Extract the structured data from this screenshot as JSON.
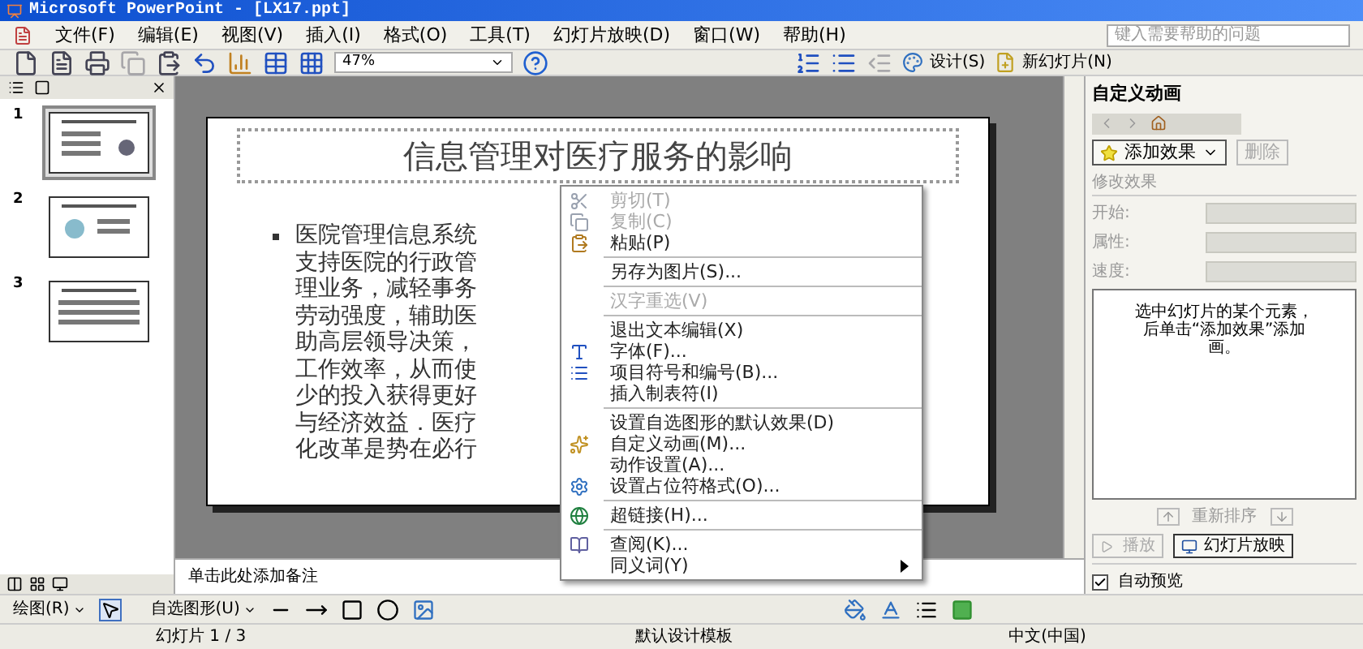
{
  "window": {
    "title": "Microsoft PowerPoint - [LX17.ppt]"
  },
  "menu_bar": [
    "文件(F)",
    "编辑(E)",
    "视图(V)",
    "插入(I)",
    "格式(O)",
    "工具(T)",
    "幻灯片放映(D)",
    "窗口(W)",
    "帮助(H)"
  ],
  "help_box": {
    "placeholder": "键入需要帮助的问题"
  },
  "toolbar": {
    "zoom": "47%",
    "design_button": "设计(S)",
    "new_slide_button": "新幻灯片(N)"
  },
  "slides_pane": {
    "slides": [
      {
        "number": "1",
        "selected": true
      },
      {
        "number": "2",
        "selected": false
      },
      {
        "number": "3",
        "selected": false
      }
    ]
  },
  "slide": {
    "title": "信息管理对医疗服务的影响",
    "body_lines": [
      "医院管理信息系统",
      "支持医院的行政管",
      "理业务，减轻事务",
      "劳动强度，辅助医",
      "助高层领导决策，",
      "工作效率，从而使",
      "少的投入获得更好",
      "与经济效益．医疗",
      "化改革是势在必行"
    ]
  },
  "notes": {
    "text": "单击此处添加备注"
  },
  "context_menu": {
    "groups": [
      [
        {
          "label": "剪切(T)",
          "disabled": true,
          "submenu": false
        },
        {
          "label": "复制(C)",
          "disabled": true,
          "submenu": false
        },
        {
          "label": "粘贴(P)",
          "disabled": false,
          "submenu": false
        }
      ],
      [
        {
          "label": "另存为图片(S)...",
          "disabled": false,
          "submenu": false
        }
      ],
      [
        {
          "label": "汉字重选(V)",
          "disabled": true,
          "submenu": false
        }
      ],
      [
        {
          "label": "退出文本编辑(X)",
          "disabled": false,
          "submenu": false
        },
        {
          "label": "字体(F)...",
          "disabled": false,
          "submenu": false
        },
        {
          "label": "项目符号和编号(B)...",
          "disabled": false,
          "submenu": false
        },
        {
          "label": "插入制表符(I)",
          "disabled": false,
          "submenu": false
        }
      ],
      [
        {
          "label": "设置自选图形的默认效果(D)",
          "disabled": false,
          "submenu": false
        },
        {
          "label": "自定义动画(M)...",
          "disabled": false,
          "submenu": false
        },
        {
          "label": "动作设置(A)...",
          "disabled": false,
          "submenu": false
        },
        {
          "label": "设置占位符格式(O)...",
          "disabled": false,
          "submenu": false
        }
      ],
      [
        {
          "label": "超链接(H)...",
          "disabled": false,
          "submenu": false
        }
      ],
      [
        {
          "label": "查阅(K)...",
          "disabled": false,
          "submenu": false
        },
        {
          "label": "同义词(Y)",
          "disabled": false,
          "submenu": true
        }
      ]
    ]
  },
  "task_pane": {
    "title": "自定义动画",
    "add_effect_button": "添加效果",
    "remove_button": {
      "label": "删除",
      "disabled": true
    },
    "modify_header": "修改效果",
    "properties": [
      {
        "label": "开始:"
      },
      {
        "label": "属性:"
      },
      {
        "label": "速度:"
      }
    ],
    "hint_lines": [
      "选中幻灯片的某个元素，",
      "后单击“添加效果”添加",
      "画。"
    ],
    "reorder_label": "重新排序",
    "play_button": {
      "label": "播放",
      "disabled": true
    },
    "slideshow_button": "幻灯片放映",
    "autopreview": {
      "label": "自动预览",
      "checked": true
    }
  },
  "drawing_toolbar": {
    "draw_menu": "绘图(R)",
    "autoshapes_menu": "自选图形(U)"
  },
  "status_bar": {
    "slide_position": "幻灯片 1 / 3",
    "design_template": "默认设计模板",
    "language": "中文(中国)"
  }
}
